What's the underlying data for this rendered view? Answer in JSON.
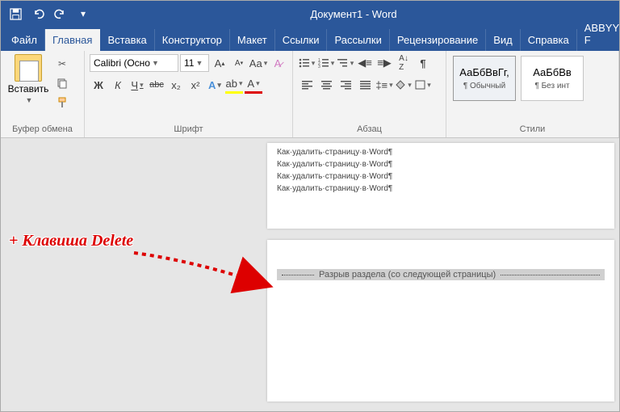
{
  "title": "Документ1 - Word",
  "tabs": {
    "file": "Файл",
    "home": "Главная",
    "insert": "Вставка",
    "design": "Конструктор",
    "layout": "Макет",
    "references": "Ссылки",
    "mailings": "Рассылки",
    "review": "Рецензирование",
    "view": "Вид",
    "help": "Справка",
    "abbyy": "ABBYY F"
  },
  "clipboard": {
    "paste": "Вставить",
    "group": "Буфер обмена"
  },
  "font": {
    "group": "Шрифт",
    "family": "Calibri (Осно",
    "size": "11",
    "bold": "Ж",
    "italic": "К",
    "underline": "Ч",
    "strike": "abc",
    "sub": "x₂",
    "sup": "x²"
  },
  "paragraph": {
    "group": "Абзац"
  },
  "styles": {
    "group": "Стили",
    "sample": "АаБбВвГг,",
    "normal": "¶ Обычный",
    "sample2": "АаБбВв",
    "nospacing": "¶ Без инт"
  },
  "doc": {
    "line": "Как·удалить·страницу·в·Word¶",
    "break": "Разрыв раздела (со следующей страницы)"
  },
  "annotation": "+ Клавиша Delete"
}
